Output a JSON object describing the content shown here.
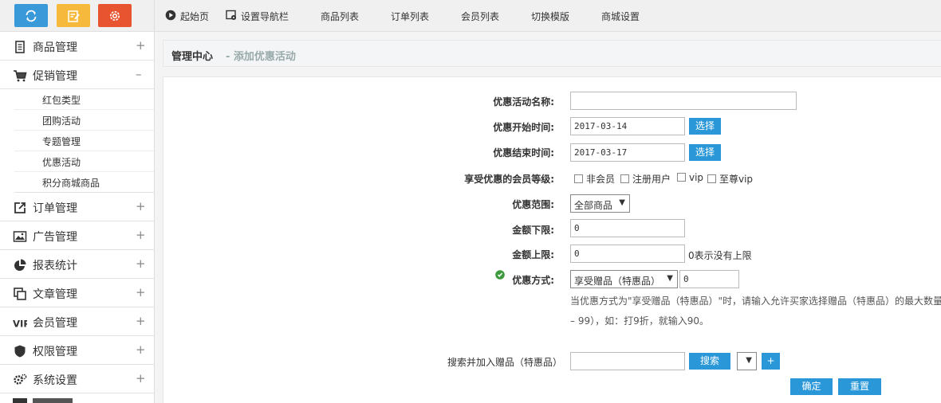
{
  "colors": {
    "tb1": "#3a9ad9",
    "tb2": "#f6b93b",
    "tb3": "#e8542f",
    "accent": "#2a98d8"
  },
  "sidebar": {
    "top_icons": [
      "refresh-icon",
      "edit-icon",
      "gear-icon"
    ],
    "menus": [
      {
        "label": "商品管理",
        "icon": "goods-icon",
        "toggle": "+"
      },
      {
        "label": "促销管理",
        "icon": "cart-icon",
        "toggle": "–"
      },
      {
        "label": "订单管理",
        "icon": "external-link-icon",
        "toggle": "+"
      },
      {
        "label": "广告管理",
        "icon": "image-icon",
        "toggle": "+"
      },
      {
        "label": "报表统计",
        "icon": "pie-chart-icon",
        "toggle": "+"
      },
      {
        "label": "文章管理",
        "icon": "copy-icon",
        "toggle": "+"
      },
      {
        "label": "会员管理",
        "icon": "vip-icon",
        "toggle": "+"
      },
      {
        "label": "权限管理",
        "icon": "shield-icon",
        "toggle": "+"
      },
      {
        "label": "系统设置",
        "icon": "cogs-icon",
        "toggle": "+"
      }
    ],
    "submenus": [
      "红包类型",
      "团购活动",
      "专题管理",
      "优惠活动",
      "积分商城商品"
    ]
  },
  "topnav": {
    "start": "起始页",
    "setnav": "设置导航栏",
    "goods": "商品列表",
    "orders": "订单列表",
    "members": "会员列表",
    "template": "切换模版",
    "shop": "商城设置"
  },
  "title": {
    "main": "管理中心",
    "sub": "- 添加优惠活动"
  },
  "form": {
    "name_label": "优惠活动名称:",
    "name_value": "",
    "start_label": "优惠开始时间:",
    "start_value": "2017-03-14",
    "end_label": "优惠结束时间:",
    "end_value": "2017-03-17",
    "select_btn": "选择",
    "level_label": "享受优惠的会员等级:",
    "levels": [
      "非会员",
      "注册用户",
      "vip",
      "至尊vip"
    ],
    "range_label": "优惠范围:",
    "range_value": "全部商品",
    "min_label": "金额下限:",
    "min_value": "0",
    "max_label": "金额上限:",
    "max_value": "0",
    "max_hint": "0表示没有上限",
    "type_label": "优惠方式:",
    "type_value": "享受赠品（特惠品）",
    "type_amount": "0",
    "type_note1": "当优惠方式为\"享受赠品（特惠品）\"时，请输入允许买家选择赠品（特惠品）的最大数量",
    "type_note2": "– 99），如：打9折，就输入90。",
    "search_label": "搜索并加入赠品（特惠品）",
    "search_value": "",
    "search_btn": "搜索",
    "add_btn": "+",
    "ok_btn": "确定",
    "reset_btn": "重置"
  }
}
